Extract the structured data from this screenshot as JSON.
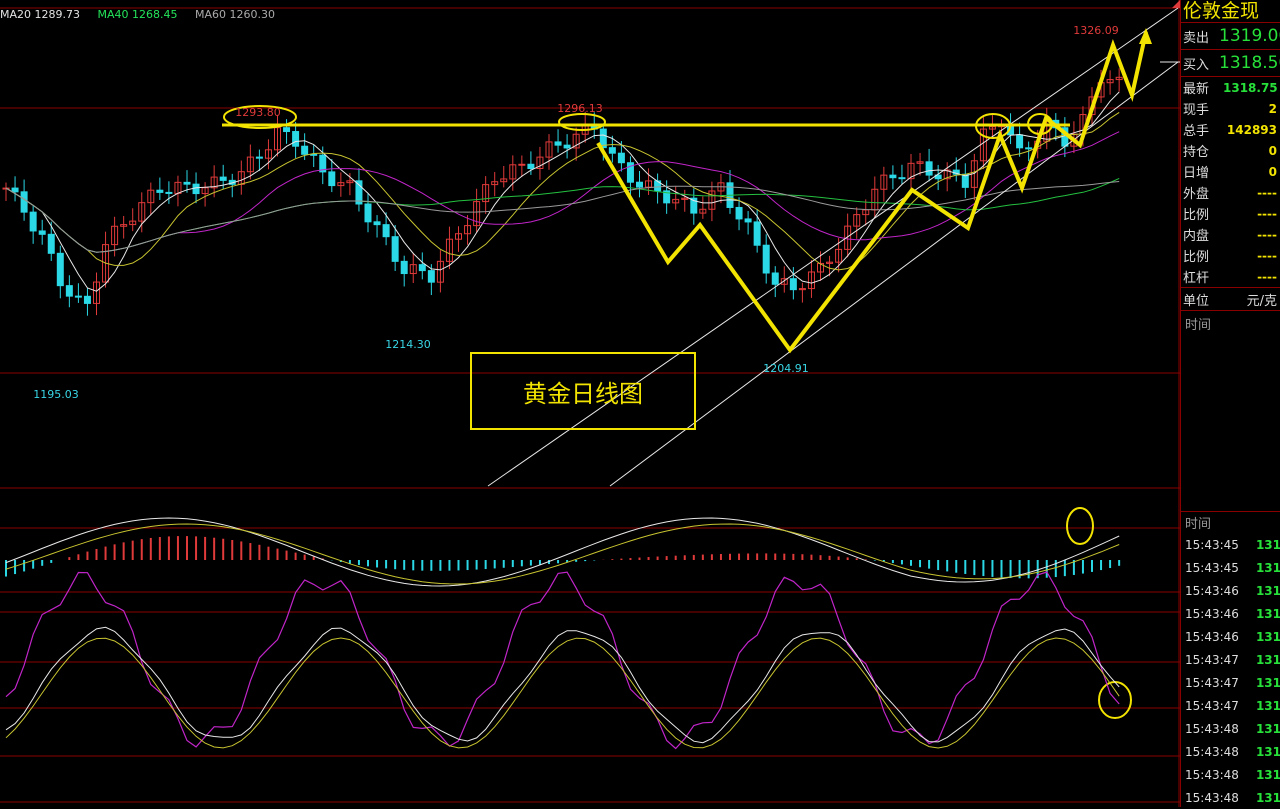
{
  "ma_legend": [
    {
      "text": "MA20 1289.73",
      "color": "#e3e3e3"
    },
    {
      "text": "MA40 1268.45",
      "color": "#24e35a"
    },
    {
      "text": "MA60 1260.30",
      "color": "#aaaaaa"
    }
  ],
  "chart_data": {
    "type": "candlestick",
    "title": "黄金日线图",
    "price_labels": [
      {
        "text": "1195.03",
        "color": "#39d6e6"
      },
      {
        "text": "1293.80",
        "color": "#e03a3a"
      },
      {
        "text": "1214.30",
        "color": "#39d6e6"
      },
      {
        "text": "1296.13",
        "color": "#e03a3a"
      },
      {
        "text": "1204.91",
        "color": "#39d6e6"
      },
      {
        "text": "1326.09",
        "color": "#e03a3a"
      }
    ],
    "key_prices": {
      "low_1": 1195.03,
      "high_1": 1293.8,
      "low_2": 1214.3,
      "high_2": 1296.13,
      "low_3": 1204.91,
      "high_3": 1326.09
    },
    "colors": {
      "up": "#e03a3a",
      "down": "#2ad8e6",
      "annotation": "#f2e300",
      "ma_white": "#e8e8e8",
      "ma_yellow": "#c7c330",
      "ma_magenta": "#c025c8",
      "ma_green": "#24c040",
      "ma_gray": "#9a9a9a",
      "grid": "#8a0000"
    }
  },
  "panel": {
    "title": "伦敦金现",
    "sell_label": "卖出",
    "sell_value": "1319.00",
    "buy_label": "买入",
    "buy_value": "1318.50",
    "stats": [
      {
        "label": "最新",
        "value": "1318.75",
        "color": "#27e13a"
      },
      {
        "label": "现手",
        "value": "2",
        "color": "#f2e300"
      },
      {
        "label": "总手",
        "value": "142893",
        "color": "#f2e300"
      },
      {
        "label": "持仓",
        "value": "0",
        "color": "#f2e300"
      },
      {
        "label": "日增",
        "value": "0",
        "color": "#f2e300"
      },
      {
        "label": "外盘",
        "value": "----",
        "color": "#f2e300"
      },
      {
        "label": "比例",
        "value": "----",
        "color": "#f2e300"
      },
      {
        "label": "内盘",
        "value": "----",
        "color": "#f2e300"
      },
      {
        "label": "比例",
        "value": "----",
        "color": "#f2e300"
      },
      {
        "label": "杠杆",
        "value": "----",
        "color": "#f2e300"
      }
    ],
    "unit_label": "单位",
    "unit_value": "元/克",
    "time_header": "时间",
    "time_header2": "时间",
    "ticks": [
      {
        "time": "15:43:45",
        "price": "131"
      },
      {
        "time": "15:43:45",
        "price": "131"
      },
      {
        "time": "15:43:46",
        "price": "131"
      },
      {
        "time": "15:43:46",
        "price": "131"
      },
      {
        "time": "15:43:46",
        "price": "131"
      },
      {
        "time": "15:43:47",
        "price": "131"
      },
      {
        "time": "15:43:47",
        "price": "131"
      },
      {
        "time": "15:43:47",
        "price": "131"
      },
      {
        "time": "15:43:48",
        "price": "131"
      },
      {
        "time": "15:43:48",
        "price": "131"
      },
      {
        "time": "15:43:48",
        "price": "131"
      },
      {
        "time": "15:43:48",
        "price": "131"
      }
    ]
  }
}
